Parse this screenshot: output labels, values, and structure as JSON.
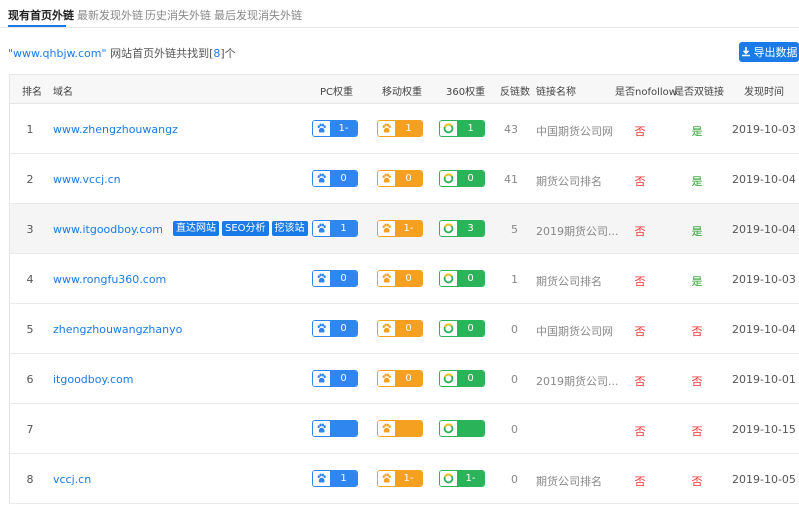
{
  "tabs": [
    {
      "label": "现有首页外链",
      "active": true
    },
    {
      "label": "最新发现外链",
      "active": false
    },
    {
      "label": "历史消失外链",
      "active": false
    },
    {
      "label": "最后发现消失外链",
      "active": false
    }
  ],
  "summary": {
    "domain_quoted": "\"www.qhbjw.com\"",
    "text_before": " 网站首页外链共找到[",
    "count": "8",
    "text_after": "]个"
  },
  "export_button": "导出数据",
  "headers": {
    "rank": "排名",
    "domain": "域名",
    "pc": "PC权重",
    "mobile": "移动权重",
    "w360": "360权重",
    "backlinks": "反链数",
    "link_name": "链接名称",
    "nofollow": "是否nofollow",
    "double": "是否双链接",
    "date": "发现时间"
  },
  "tools": [
    "直达网站",
    "SEO分析",
    "挖该站"
  ],
  "colors": {
    "accent": "#1a7be8",
    "pc": "#2f86ee",
    "mobile": "#f5a020",
    "w360": "#2bb35a",
    "no": "#e33333",
    "yes": "#2a9d2a"
  },
  "rows": [
    {
      "rank": "1",
      "domain": "www.zhengzhouwangz",
      "pc": "1-",
      "mobile": "1",
      "w360": "1",
      "backlinks": "43",
      "link_name": "中国期货公司网",
      "nofollow": "否",
      "double": "是",
      "date": "2019-10-03"
    },
    {
      "rank": "2",
      "domain": "www.vccj.cn",
      "pc": "0",
      "mobile": "0",
      "w360": "0",
      "backlinks": "41",
      "link_name": "期货公司排名",
      "nofollow": "否",
      "double": "是",
      "date": "2019-10-04"
    },
    {
      "rank": "3",
      "domain": "www.itgoodboy.com",
      "pc": "1",
      "mobile": "1-",
      "w360": "3",
      "backlinks": "5",
      "link_name": "2019期货公司...",
      "nofollow": "否",
      "double": "是",
      "date": "2019-10-04"
    },
    {
      "rank": "4",
      "domain": "www.rongfu360.com",
      "pc": "0",
      "mobile": "0",
      "w360": "0",
      "backlinks": "1",
      "link_name": "期货公司排名",
      "nofollow": "否",
      "double": "是",
      "date": "2019-10-03"
    },
    {
      "rank": "5",
      "domain": "zhengzhouwangzhanyo",
      "pc": "0",
      "mobile": "0",
      "w360": "0",
      "backlinks": "0",
      "link_name": "中国期货公司网",
      "nofollow": "否",
      "double": "否",
      "date": "2019-10-04"
    },
    {
      "rank": "6",
      "domain": "itgoodboy.com",
      "pc": "0",
      "mobile": "0",
      "w360": "0",
      "backlinks": "0",
      "link_name": "2019期货公司...",
      "nofollow": "否",
      "double": "否",
      "date": "2019-10-01"
    },
    {
      "rank": "7",
      "domain": "",
      "pc": "",
      "mobile": "",
      "w360": "",
      "backlinks": "0",
      "link_name": "",
      "nofollow": "否",
      "double": "否",
      "date": "2019-10-15"
    },
    {
      "rank": "8",
      "domain": "vccj.cn",
      "pc": "1",
      "mobile": "1-",
      "w360": "1-",
      "backlinks": "0",
      "link_name": "期货公司排名",
      "nofollow": "否",
      "double": "否",
      "date": "2019-10-05"
    }
  ]
}
